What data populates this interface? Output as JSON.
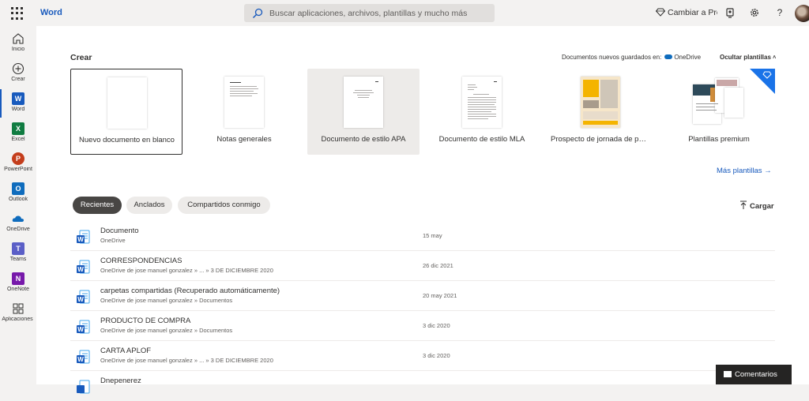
{
  "topbar": {
    "app_name": "Word",
    "search_placeholder": "Buscar aplicaciones, archivos, plantillas y mucho más",
    "premium_label": "Cambiar a Premium"
  },
  "rail": [
    {
      "label": "Inicio"
    },
    {
      "label": "Crear"
    },
    {
      "label": "Word",
      "letter": "W",
      "color": "#185abd"
    },
    {
      "label": "Excel",
      "letter": "X",
      "color": "#107c41"
    },
    {
      "label": "PowerPoint",
      "letter": "P",
      "color": "#c43e1c"
    },
    {
      "label": "Outlook",
      "letter": "O",
      "color": "#0f6cbd"
    },
    {
      "label": "OneDrive"
    },
    {
      "label": "Teams",
      "letter": "T",
      "color": "#5b5fc7"
    },
    {
      "label": "OneNote",
      "letter": "N",
      "color": "#7719aa"
    },
    {
      "label": "Aplicaciones"
    }
  ],
  "create": {
    "title": "Crear",
    "saved_to_label": "Documentos nuevos guardados en:",
    "saved_to_location": "OneDrive",
    "hide_templates": "Ocultar plantillas",
    "more_templates": "Más plantillas",
    "templates": [
      {
        "label": "Nuevo documento en blanco"
      },
      {
        "label": "Notas generales"
      },
      {
        "label": "Documento de estilo APA"
      },
      {
        "label": "Documento de estilo MLA"
      },
      {
        "label": "Prospecto de jornada de puertas abiertas"
      },
      {
        "label": "Plantillas premium"
      }
    ]
  },
  "tabs": {
    "recent": "Recientes",
    "pinned": "Anclados",
    "shared": "Compartidos conmigo",
    "upload": "Cargar"
  },
  "files": [
    {
      "name": "Documento",
      "path": "OneDrive",
      "date": "15 may"
    },
    {
      "name": "CORRESPONDENCIAS",
      "path": "OneDrive de jose manuel gonzalez » ... » 3 DE DICIEMBRE 2020",
      "date": "26 dic 2021"
    },
    {
      "name": "carpetas compartidas (Recuperado automáticamente)",
      "path": "OneDrive de jose manuel gonzalez » Documentos",
      "date": "20 may 2021"
    },
    {
      "name": "PRODUCTO DE COMPRA",
      "path": "OneDrive de jose manuel gonzalez » Documentos",
      "date": "3 dic 2020"
    },
    {
      "name": "CARTA APLOF",
      "path": "OneDrive de jose manuel gonzalez » ... » 3 DE DICIEMBRE 2020",
      "date": "3 dic 2020"
    },
    {
      "name": "Dnepenerez",
      "path": "",
      "date": ""
    }
  ],
  "feedback_label": "Comentarios"
}
